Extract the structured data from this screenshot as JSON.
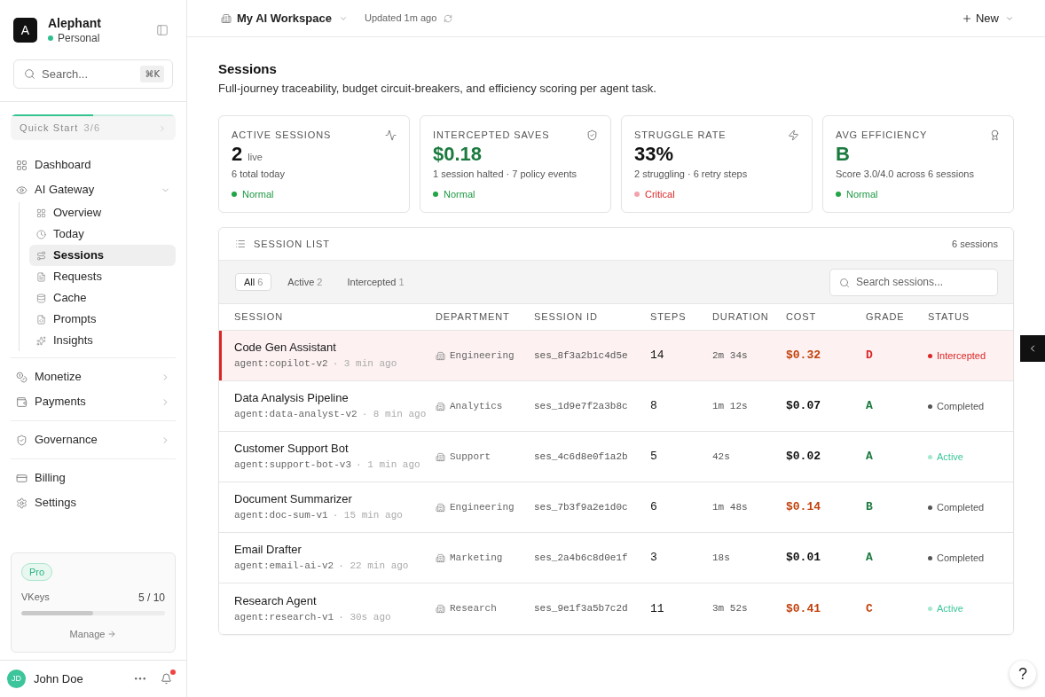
{
  "sidebar": {
    "workspace": {
      "logo": "A",
      "name": "Alephant",
      "plan": "Personal"
    },
    "search": {
      "placeholder": "Search...",
      "shortcut": "⌘K"
    },
    "quick_start": {
      "label": "Quick Start",
      "progress": "3/6",
      "level": 0.5
    },
    "nav_groups": [
      [
        {
          "label": "Dashboard",
          "kind": "link",
          "selected": false
        },
        {
          "label": "AI Gateway",
          "kind": "group",
          "expanded": true,
          "selected": false,
          "children": [
            {
              "label": "Overview",
              "selected": false
            },
            {
              "label": "Today",
              "selected": false
            },
            {
              "label": "Sessions",
              "selected": true
            },
            {
              "label": "Requests",
              "selected": false
            },
            {
              "label": "Cache",
              "selected": false
            },
            {
              "label": "Prompts",
              "selected": false
            },
            {
              "label": "Insights",
              "selected": false
            }
          ]
        }
      ],
      [
        {
          "label": "Monetize",
          "kind": "group",
          "expanded": false,
          "selected": false
        },
        {
          "label": "Payments",
          "kind": "group",
          "expanded": false,
          "selected": false
        }
      ],
      [
        {
          "label": "Governance",
          "kind": "group",
          "expanded": false,
          "selected": false
        }
      ],
      [
        {
          "label": "Billing",
          "kind": "link",
          "selected": false
        },
        {
          "label": "Settings",
          "kind": "link",
          "selected": false
        }
      ]
    ],
    "plan_card": {
      "badge": "Pro",
      "meter_label": "VKeys",
      "meter_value": "5 / 10",
      "level": 0.5,
      "action": "Manage"
    },
    "user": {
      "initials": "JD",
      "name": "John Doe",
      "has_notifications": true
    }
  },
  "top_bar": {
    "workspace": "My AI Workspace",
    "updated": "Updated 1m ago",
    "new_button": "New"
  },
  "page": {
    "title": "Sessions",
    "subtitle": "Full-journey traceability, budget circuit-breakers, and efficiency scoring per agent task."
  },
  "stats": [
    {
      "label": "ACTIVE SESSIONS",
      "value": {
        "text": "2",
        "color": "#111111"
      },
      "unit": "live",
      "detail": "6 total today",
      "status": {
        "label": "Normal",
        "kind": "normal"
      }
    },
    {
      "label": "INTERCEPTED SAVES",
      "value": {
        "text": "$0.18",
        "color": "#1b7a3e"
      },
      "detail": "1 session halted · 7 policy events",
      "status": {
        "label": "Normal",
        "kind": "normal"
      }
    },
    {
      "label": "STRUGGLE RATE",
      "value": {
        "text": "33%",
        "color": "#111111"
      },
      "detail": "2 struggling · 6 retry steps",
      "status": {
        "label": "Critical",
        "kind": "critical"
      }
    },
    {
      "label": "AVG EFFICIENCY",
      "value": {
        "text": "B",
        "color": "#1b7a3e"
      },
      "detail": "Score 3.0/4.0 across 6 sessions",
      "status": {
        "label": "Normal",
        "kind": "normal"
      }
    }
  ],
  "session_list": {
    "title": "SESSION LIST",
    "count": "6 sessions",
    "filters": [
      {
        "label": "All",
        "count": "6",
        "selected": true
      },
      {
        "label": "Active",
        "count": "2",
        "selected": false
      },
      {
        "label": "Intercepted",
        "count": "1",
        "selected": false
      }
    ],
    "search": {
      "placeholder": "Search sessions..."
    },
    "columns": [
      "SESSION",
      "DEPARTMENT",
      "SESSION ID",
      "STEPS",
      "DURATION",
      "COST",
      "GRADE",
      "STATUS"
    ],
    "rows": [
      {
        "name": "Code Gen Assistant",
        "agent": "agent:copilot-v2",
        "age": "· 3 min ago",
        "department": "Engineering",
        "session_id": "ses_8f3a2b1c4d5e",
        "steps": "14",
        "duration": "2m 34s",
        "cost": {
          "text": "$0.32",
          "color": "#c2410c"
        },
        "grade": {
          "text": "D",
          "color": "#dc2626"
        },
        "status": {
          "label": "Intercepted",
          "kind": "intercepted"
        },
        "highlighted": true
      },
      {
        "name": "Data Analysis Pipeline",
        "agent": "agent:data-analyst-v2",
        "age": "· 8 min ago",
        "department": "Analytics",
        "session_id": "ses_1d9e7f2a3b8c",
        "steps": "8",
        "duration": "1m 12s",
        "cost": {
          "text": "$0.07",
          "color": "#111111"
        },
        "grade": {
          "text": "A",
          "color": "#1b7a3e"
        },
        "status": {
          "label": "Completed",
          "kind": "completed"
        },
        "highlighted": false
      },
      {
        "name": "Customer Support Bot",
        "agent": "agent:support-bot-v3",
        "age": "· 1 min ago",
        "department": "Support",
        "session_id": "ses_4c6d8e0f1a2b",
        "steps": "5",
        "duration": "42s",
        "cost": {
          "text": "$0.02",
          "color": "#111111"
        },
        "grade": {
          "text": "A",
          "color": "#1b7a3e"
        },
        "status": {
          "label": "Active",
          "kind": "active"
        },
        "highlighted": false
      },
      {
        "name": "Document Summarizer",
        "agent": "agent:doc-sum-v1",
        "age": "· 15 min ago",
        "department": "Engineering",
        "session_id": "ses_7b3f9a2e1d0c",
        "steps": "6",
        "duration": "1m 48s",
        "cost": {
          "text": "$0.14",
          "color": "#c2410c"
        },
        "grade": {
          "text": "B",
          "color": "#1b7a3e"
        },
        "status": {
          "label": "Completed",
          "kind": "completed"
        },
        "highlighted": false
      },
      {
        "name": "Email Drafter",
        "agent": "agent:email-ai-v2",
        "age": "· 22 min ago",
        "department": "Marketing",
        "session_id": "ses_2a4b6c8d0e1f",
        "steps": "3",
        "duration": "18s",
        "cost": {
          "text": "$0.01",
          "color": "#111111"
        },
        "grade": {
          "text": "A",
          "color": "#1b7a3e"
        },
        "status": {
          "label": "Completed",
          "kind": "completed"
        },
        "highlighted": false
      },
      {
        "name": "Research Agent",
        "agent": "agent:research-v1",
        "age": "· 30s ago",
        "department": "Research",
        "session_id": "ses_9e1f3a5b7c2d",
        "steps": "11",
        "duration": "3m 52s",
        "cost": {
          "text": "$0.41",
          "color": "#c2410c"
        },
        "grade": {
          "text": "C",
          "color": "#c2410c"
        },
        "status": {
          "label": "Active",
          "kind": "active"
        },
        "highlighted": false
      }
    ]
  },
  "help_button": "?"
}
